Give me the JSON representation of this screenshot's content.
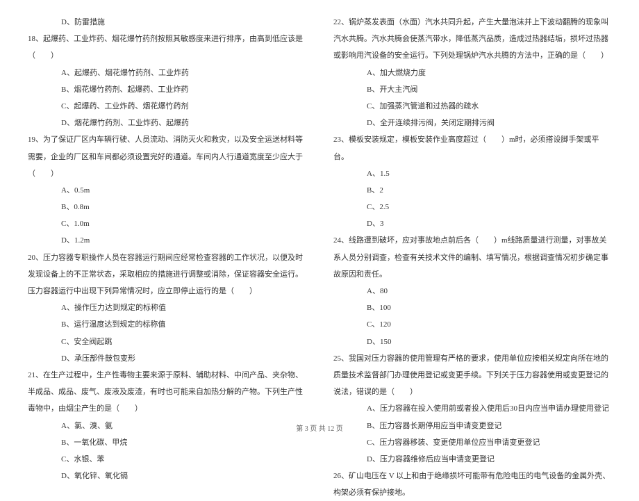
{
  "left": {
    "opt17d": "D、防雷措施",
    "q18": "18、起爆药、工业炸药、烟花爆竹药剂按照其敏感度来进行排序，由高到低应该是（　　）",
    "q18a": "A、起爆药、烟花爆竹药剂、工业炸药",
    "q18b": "B、烟花爆竹药剂、起爆药、工业炸药",
    "q18c": "C、起爆药、工业炸药、烟花爆竹药剂",
    "q18d": "D、烟花爆竹药剂、工业炸药、起爆药",
    "q19": "19、为了保证厂区内车辆行驶、人员流动、消防灭火和救灾，以及安全运送材料等需要，企业的厂区和车间都必须设置完好的通道。车间内人行通道宽度至少应大于（　　）",
    "q19a": "A、0.5m",
    "q19b": "B、0.8m",
    "q19c": "C、1.0m",
    "q19d": "D、1.2m",
    "q20": "20、压力容器专职操作人员在容器运行期间应经常检查容器的工作状况，以便及时发现设备上的不正常状态，采取相应的措施进行调整或消除，保证容器安全运行。压力容器运行中出现下列异常情况时，应立即停止运行的是（　　）",
    "q20a": "A、操作压力达到规定的标称值",
    "q20b": "B、运行温度达到规定的标称值",
    "q20c": "C、安全阀起跳",
    "q20d": "D、承压部件鼓包变形",
    "q21": "21、在生产过程中，生产性毒物主要来源于原料、辅助材料、中间产品、夹杂物、半成品、成品、废气、废液及废渣，有时也可能来自加热分解的产物。下列生产性毒物中，由烟尘产生的是（　　）",
    "q21a": "A、氯、溴、氨",
    "q21b": "B、一氧化碳、甲烷",
    "q21c": "C、水银、苯",
    "q21d": "D、氧化锌、氧化镉"
  },
  "right": {
    "q22": "22、锅炉蒸发表面（水面）汽水共同升起，产生大量泡沫并上下波动翻腾的现象叫汽水共腾。汽水共腾会使蒸汽带水，降低蒸汽品质，造成过热器结垢，损坏过热器或影响用汽设备的安全运行。下列处理锅炉汽水共腾的方法中，正确的是（　　）",
    "q22a": "A、加大燃烧力度",
    "q22b": "B、开大主汽阀",
    "q22c": "C、加强蒸汽管道和过热器的疏水",
    "q22d": "D、全开连续排污阀，关闭定期排污阀",
    "q23": "23、模板安装规定，模板安装作业高度超过（　　）m时，必须搭设脚手架或平台。",
    "q23a": "A、1.5",
    "q23b": "B、2",
    "q23c": "C、2.5",
    "q23d": "D、3",
    "q24": "24、线路遭到破坏，应对事故地点前后各（　　）m线路质量进行测量，对事故关系人员分别调查，检查有关技术文件的编制、填写情况，根据调查情况初步确定事故原因和责任。",
    "q24a": "A、80",
    "q24b": "B、100",
    "q24c": "C、120",
    "q24d": "D、150",
    "q25": "25、我国对压力容器的使用管理有严格的要求，使用单位应按相关规定向所在地的质量技术监督部门办理使用登记或变更手续。下列关于压力容器使用或变更登记的说法，错误的是（　　）",
    "q25a": "A、压力容器在投入使用前或者投入使用后30日内应当申请办理使用登记",
    "q25b": "B、压力容器长期停用应当申请变更登记",
    "q25c": "C、压力容器移装、变更使用单位应当申请变更登记",
    "q25d": "D、压力容器维修后应当申请变更登记",
    "q26": "26、矿山电压在 V 以上和由于绝缘损坏可能带有危险电压的电气设备的金属外壳、构架必须有保护接地。"
  },
  "footer": "第 3 页 共 12 页"
}
